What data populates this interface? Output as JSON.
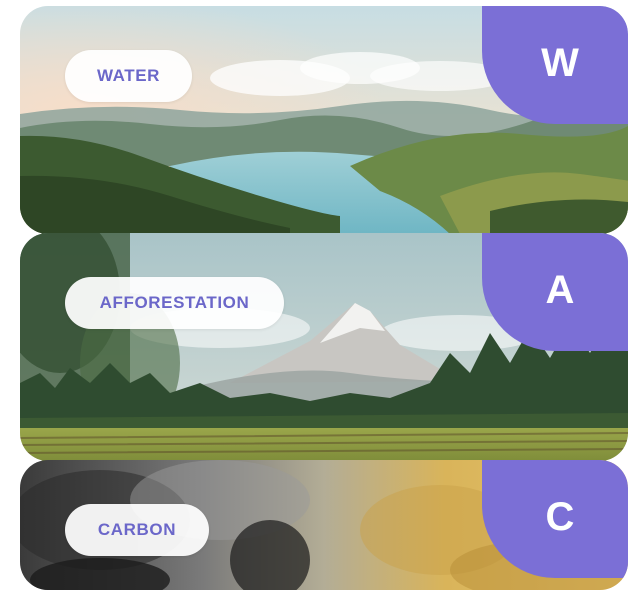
{
  "cards": [
    {
      "label": "WATER",
      "letter": "W",
      "scene": "landscape-lake"
    },
    {
      "label": "AFFORESTATION",
      "letter": "A",
      "scene": "mountain-forest-field"
    },
    {
      "label": "CARBON",
      "letter": "C",
      "scene": "smoke-and-foliage"
    }
  ],
  "colors": {
    "accent": "#7b6fd6",
    "pill_text": "#6b67c9",
    "pill_bg": "#ffffff"
  }
}
